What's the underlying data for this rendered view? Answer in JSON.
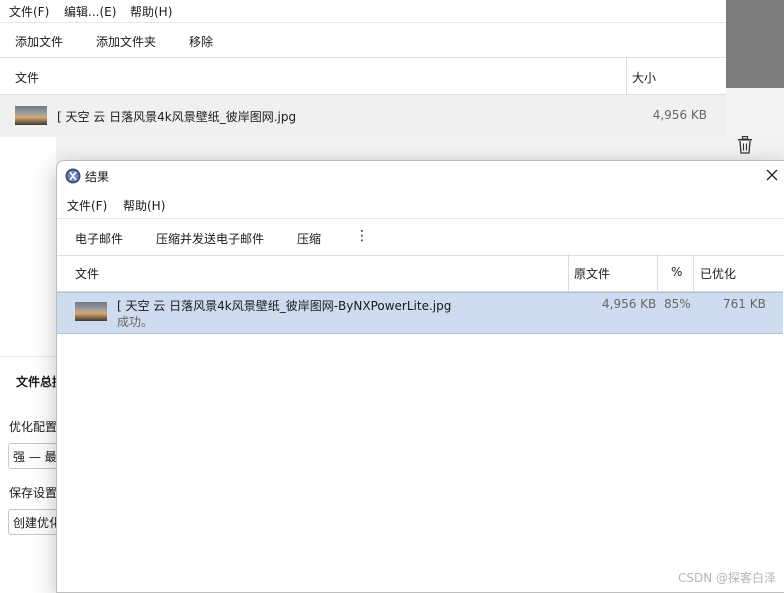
{
  "main_window": {
    "menu": [
      "文件(F)",
      "编辑...(E)",
      "帮助(H)"
    ],
    "toolbar": [
      "添加文件",
      "添加文件夹",
      "移除"
    ],
    "columns": {
      "file": "文件",
      "size": "大小"
    },
    "file_row": {
      "name": "[ 天空 云 日落风景4k风景壁纸_彼岸图网.jpg",
      "size": "4,956 KB"
    },
    "panel": {
      "summary_label": "文件总揽",
      "profile_label": "优化配置",
      "profile_value": "强 — 最",
      "save_label": "保存设置",
      "save_value": "创建优化"
    }
  },
  "dialog": {
    "title": "结果",
    "menu": [
      "文件(F)",
      "帮助(H)"
    ],
    "toolbar": [
      "电子邮件",
      "压缩并发送电子邮件",
      "压缩",
      "⋮"
    ],
    "columns": {
      "file": "文件",
      "original": "原文件",
      "percent": "%",
      "optimized": "已优化"
    },
    "result_row": {
      "name": "[ 天空 云 日落风景4k风景壁纸_彼岸图网-ByNXPowerLite.jpg",
      "status": "成功。",
      "original": "4,956 KB",
      "percent": "85%",
      "optimized": "761 KB"
    }
  },
  "watermark": "CSDN @探客白泽"
}
